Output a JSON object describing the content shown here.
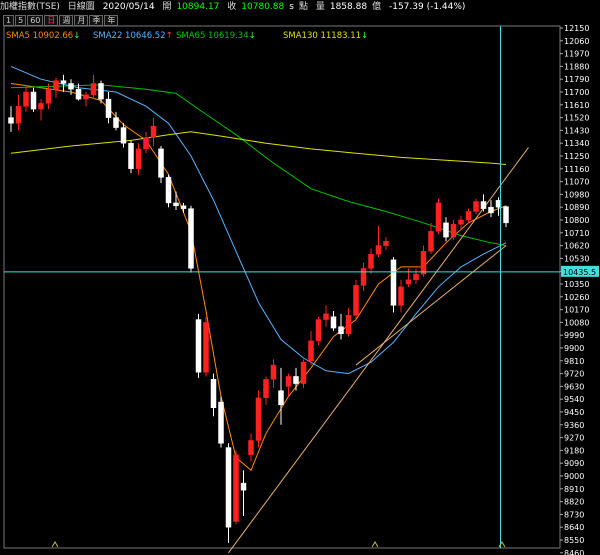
{
  "header": {
    "title": "加權指數(TSE)",
    "period": "日線圖",
    "date": "2020/05/14",
    "open_label": "開",
    "open": "10894.17",
    "close_label": "收",
    "close": "10780.88",
    "close_flag": "s",
    "unit_label": "點",
    "volume_label": "量",
    "volume": "1858.88",
    "volume_unit": "億",
    "change": "-157.39 (-1.44%)"
  },
  "tabs": [
    "1",
    "5",
    "60",
    "日",
    "週",
    "月",
    "季",
    "年"
  ],
  "active_tab": "日",
  "colors": {
    "up": "#ff2020",
    "down": "#ffffff",
    "sma5": "#ff8c00",
    "sma22": "#5ab4ff",
    "sma65": "#00c000",
    "sma130": "#e0e000",
    "trendline": "#e8b070",
    "crosshair": "#40e0e0",
    "current_tag_bg": "#40e0e0"
  },
  "chart_data": {
    "type": "candlestick",
    "y_ticks": [
      12150,
      12060,
      11970,
      11880,
      11790,
      11700,
      11610,
      11520,
      11430,
      11340,
      11250,
      11160,
      11070,
      10980,
      10890,
      10800,
      10710,
      10620,
      10530,
      10440,
      10350,
      10260,
      10170,
      10080,
      9990,
      9900,
      9810,
      9720,
      9630,
      9540,
      9450,
      9360,
      9270,
      9180,
      9090,
      9000,
      8910,
      8820,
      8730,
      8640,
      8550,
      8460
    ],
    "ylim": [
      8460,
      12150
    ],
    "current_price_tag": "10435.5",
    "series": [
      {
        "name": "SMA5",
        "value": "10902.66",
        "arrow": "↓"
      },
      {
        "name": "SMA22",
        "value": "10646.52",
        "arrow": "↑"
      },
      {
        "name": "SMA65",
        "value": "10619.34",
        "arrow": "↓"
      },
      {
        "name": "SMA130",
        "value": "11183.11",
        "arrow": "↓"
      }
    ],
    "candles": [
      [
        11520,
        11600,
        11420,
        11480
      ],
      [
        11480,
        11680,
        11430,
        11600
      ],
      [
        11600,
        11750,
        11560,
        11700
      ],
      [
        11700,
        11730,
        11560,
        11580
      ],
      [
        11580,
        11650,
        11500,
        11620
      ],
      [
        11620,
        11760,
        11580,
        11720
      ],
      [
        11720,
        11800,
        11660,
        11780
      ],
      [
        11780,
        11820,
        11700,
        11760
      ],
      [
        11760,
        11790,
        11680,
        11720
      ],
      [
        11720,
        11760,
        11640,
        11650
      ],
      [
        11650,
        11700,
        11600,
        11680
      ],
      [
        11680,
        11820,
        11650,
        11760
      ],
      [
        11760,
        11780,
        11620,
        11650
      ],
      [
        11650,
        11700,
        11480,
        11520
      ],
      [
        11520,
        11560,
        11430,
        11450
      ],
      [
        11450,
        11480,
        11310,
        11340
      ],
      [
        11340,
        11360,
        11130,
        11160
      ],
      [
        11160,
        11340,
        11120,
        11300
      ],
      [
        11300,
        11420,
        11270,
        11380
      ],
      [
        11380,
        11520,
        11320,
        11460
      ],
      [
        11300,
        11320,
        11060,
        11100
      ],
      [
        11100,
        11120,
        10890,
        10920
      ],
      [
        10920,
        11000,
        10870,
        10900
      ],
      [
        10900,
        10920,
        10850,
        10880
      ],
      [
        10880,
        10900,
        10430,
        10460
      ],
      [
        10100,
        10140,
        9690,
        9730
      ],
      [
        9730,
        10120,
        9700,
        10080
      ],
      [
        9680,
        9720,
        9420,
        9480
      ],
      [
        9520,
        9560,
        9200,
        9230
      ],
      [
        9200,
        9230,
        8530,
        8640
      ],
      [
        8680,
        9180,
        8660,
        9150
      ],
      [
        8950,
        9040,
        8720,
        8900
      ],
      [
        9150,
        9300,
        9100,
        9250
      ],
      [
        9250,
        9600,
        9200,
        9550
      ],
      [
        9550,
        9700,
        9500,
        9680
      ],
      [
        9680,
        9820,
        9620,
        9780
      ],
      [
        9600,
        9760,
        9360,
        9500
      ],
      [
        9630,
        9720,
        9560,
        9700
      ],
      [
        9700,
        9760,
        9600,
        9650
      ],
      [
        9650,
        9820,
        9620,
        9800
      ],
      [
        9810,
        10020,
        9780,
        9950
      ],
      [
        9950,
        10120,
        9920,
        10100
      ],
      [
        10100,
        10200,
        10050,
        10140
      ],
      [
        10120,
        10160,
        10020,
        10040
      ],
      [
        10050,
        10140,
        9960,
        10000
      ],
      [
        10000,
        10180,
        9980,
        10130
      ],
      [
        10130,
        10380,
        10100,
        10340
      ],
      [
        10340,
        10500,
        10300,
        10460
      ],
      [
        10460,
        10600,
        10420,
        10560
      ],
      [
        10560,
        10760,
        10540,
        10620
      ],
      [
        10620,
        10680,
        10590,
        10650
      ],
      [
        10520,
        10540,
        10150,
        10200
      ],
      [
        10200,
        10380,
        10150,
        10330
      ],
      [
        10350,
        10460,
        10330,
        10380
      ],
      [
        10380,
        10460,
        10350,
        10420
      ],
      [
        10420,
        10620,
        10400,
        10580
      ],
      [
        10580,
        10780,
        10560,
        10720
      ],
      [
        10720,
        10950,
        10700,
        10920
      ],
      [
        10780,
        10820,
        10650,
        10680
      ],
      [
        10680,
        10800,
        10660,
        10770
      ],
      [
        10770,
        10830,
        10730,
        10800
      ],
      [
        10800,
        10880,
        10780,
        10860
      ],
      [
        10860,
        10950,
        10840,
        10930
      ],
      [
        10930,
        10980,
        10860,
        10880
      ],
      [
        10890,
        10940,
        10820,
        10850
      ],
      [
        10938,
        10960,
        10830,
        10890
      ],
      [
        10894,
        10900,
        10750,
        10780
      ]
    ],
    "sma_curves": {
      "SMA5": [
        [
          0,
          11760
        ],
        [
          8,
          11700
        ],
        [
          12,
          11640
        ],
        [
          15,
          11470
        ],
        [
          18,
          11360
        ],
        [
          21,
          11120
        ],
        [
          24,
          10720
        ],
        [
          26,
          10160
        ],
        [
          28,
          9560
        ],
        [
          30,
          9130
        ],
        [
          32,
          9040
        ],
        [
          34,
          9300
        ],
        [
          37,
          9560
        ],
        [
          40,
          9760
        ],
        [
          43,
          9980
        ],
        [
          46,
          10100
        ],
        [
          49,
          10350
        ],
        [
          52,
          10470
        ],
        [
          55,
          10470
        ],
        [
          58,
          10640
        ],
        [
          61,
          10780
        ],
        [
          64,
          10860
        ],
        [
          66,
          10900
        ]
      ],
      "SMA22": [
        [
          0,
          11880
        ],
        [
          4,
          11790
        ],
        [
          9,
          11730
        ],
        [
          14,
          11700
        ],
        [
          18,
          11600
        ],
        [
          21,
          11480
        ],
        [
          24,
          11250
        ],
        [
          27,
          10940
        ],
        [
          30,
          10580
        ],
        [
          33,
          10220
        ],
        [
          36,
          9960
        ],
        [
          39,
          9830
        ],
        [
          42,
          9740
        ],
        [
          45,
          9720
        ],
        [
          48,
          9800
        ],
        [
          51,
          9940
        ],
        [
          54,
          10140
        ],
        [
          57,
          10330
        ],
        [
          60,
          10470
        ],
        [
          63,
          10560
        ],
        [
          66,
          10640
        ]
      ],
      "SMA65": [
        [
          0,
          11730
        ],
        [
          6,
          11740
        ],
        [
          12,
          11750
        ],
        [
          18,
          11720
        ],
        [
          22,
          11690
        ],
        [
          25,
          11580
        ],
        [
          30,
          11400
        ],
        [
          35,
          11200
        ],
        [
          40,
          11020
        ],
        [
          45,
          10930
        ],
        [
          50,
          10860
        ],
        [
          55,
          10780
        ],
        [
          60,
          10690
        ],
        [
          64,
          10640
        ],
        [
          66,
          10620
        ]
      ],
      "SMA130": [
        [
          0,
          11270
        ],
        [
          8,
          11320
        ],
        [
          16,
          11360
        ],
        [
          21,
          11400
        ],
        [
          24,
          11420
        ],
        [
          28,
          11390
        ],
        [
          34,
          11340
        ],
        [
          40,
          11300
        ],
        [
          46,
          11270
        ],
        [
          52,
          11240
        ],
        [
          58,
          11220
        ],
        [
          64,
          11200
        ],
        [
          66,
          11190
        ]
      ]
    },
    "trendlines": [
      {
        "from": [
          29,
          8460
        ],
        "to": [
          69,
          11310
        ]
      },
      {
        "from": [
          46,
          9780
        ],
        "to": [
          66,
          10620
        ]
      }
    ],
    "crosshair": {
      "index": 65,
      "value": 10435.5
    }
  }
}
